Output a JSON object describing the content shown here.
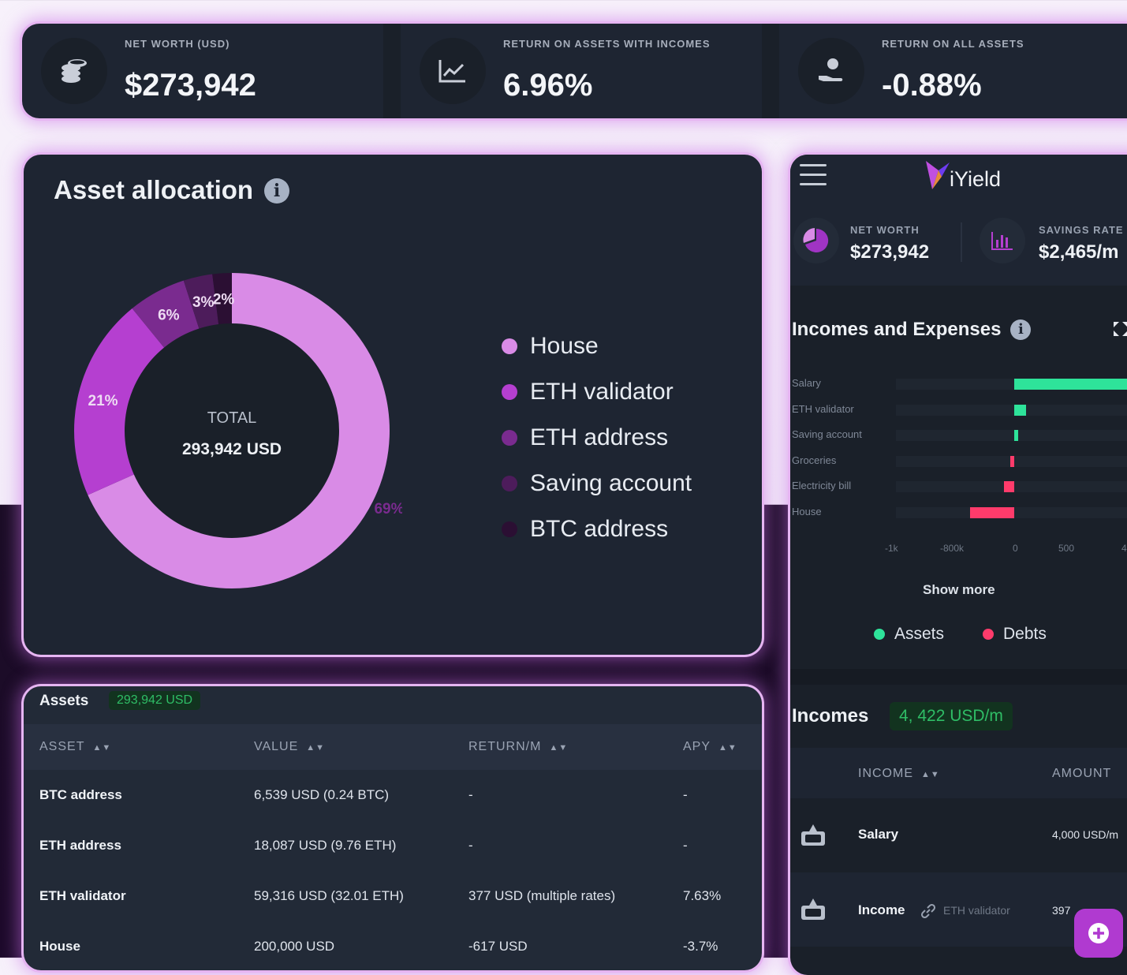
{
  "stats": [
    {
      "label": "NET WORTH (USD)",
      "value": "$273,942",
      "icon": "coins-icon"
    },
    {
      "label": "RETURN ON ASSETS WITH INCOMES",
      "value": "6.96%",
      "icon": "chart-line-icon"
    },
    {
      "label": "RETURN ON ALL ASSETS",
      "value": "-0.88%",
      "icon": "hand-coin-icon"
    }
  ],
  "allocation": {
    "title": "Asset allocation",
    "info_icon": "info-icon",
    "center_label": "TOTAL",
    "center_value": "293,942 USD",
    "legend": [
      {
        "label": "House",
        "color": "#d98be6"
      },
      {
        "label": "ETH validator",
        "color": "#b53fd0"
      },
      {
        "label": "ETH address",
        "color": "#7a2b8f"
      },
      {
        "label": "Saving account",
        "color": "#4d1c5b"
      },
      {
        "label": "BTC address",
        "color": "#2b0f33"
      }
    ]
  },
  "chart_data": {
    "type": "pie",
    "categories": [
      "House",
      "ETH validator",
      "ETH address",
      "Saving account",
      "BTC address"
    ],
    "values": [
      69,
      21,
      6,
      3,
      2
    ],
    "value_labels": [
      "69%",
      "21%",
      "6%",
      "3%",
      "2%"
    ],
    "colors": [
      "#d98be6",
      "#b53fd0",
      "#7a2b8f",
      "#4d1c5b",
      "#2b0f33"
    ]
  },
  "assets_table": {
    "title": "Assets",
    "total_badge": "293,942 USD",
    "columns": [
      "ASSET",
      "VALUE",
      "RETURN/M",
      "APY"
    ],
    "sort_icon": "sort-icon",
    "rows": [
      [
        "BTC address",
        "6,539 USD (0.24 BTC)",
        "-",
        "-"
      ],
      [
        "ETH address",
        "18,087 USD (9.76 ETH)",
        "-",
        "-"
      ],
      [
        "ETH validator",
        "59,316 USD (32.01 ETH)",
        "377 USD (multiple rates)",
        "7.63%"
      ],
      [
        "House",
        "200,000 USD",
        "-617 USD",
        "-3.7%"
      ]
    ]
  },
  "mobile": {
    "brand": "iYield",
    "menu_icon": "hamburger-menu-icon",
    "stats": [
      {
        "label": "NET WORTH",
        "value": "$273,942",
        "icon": "pie-chart-icon"
      },
      {
        "label": "SAVINGS RATE",
        "value": "$2,465/m",
        "icon": "bar-chart-icon"
      }
    ],
    "incomes_expenses": {
      "title": "Incomes and Expenses",
      "expand_icon": "expand-icon",
      "show_more": "Show more",
      "legend": [
        {
          "label": "Assets",
          "color": "#2ee39a"
        },
        {
          "label": "Debts",
          "color": "#ff3b6b"
        }
      ],
      "bars": [
        {
          "label": "Salary",
          "value": 4000,
          "color": "#2ee39a"
        },
        {
          "label": "ETH validator",
          "value": 377,
          "color": "#2ee39a"
        },
        {
          "label": "Saving account",
          "value": 45,
          "color": "#2ee39a"
        },
        {
          "label": "Groceries",
          "value": -50,
          "color": "#ff3b6b"
        },
        {
          "label": "Electricity bill",
          "value": -150,
          "color": "#ff3b6b"
        },
        {
          "label": "House",
          "value": -617,
          "color": "#ff3b6b"
        }
      ],
      "x_ticks": [
        "-1k",
        "-800k",
        "0",
        "500",
        "4"
      ]
    },
    "incomes": {
      "title": "Incomes",
      "badge": "4, 422 USD/m",
      "columns": [
        "INCOME",
        "AMOUNT"
      ],
      "rows": [
        {
          "icon": "money-bag-icon",
          "name": "Salary",
          "link": "",
          "amount": "4,000 USD/m"
        },
        {
          "icon": "money-bag-icon",
          "name": "Income",
          "link": "ETH validator",
          "amount": "397"
        }
      ]
    },
    "fab_icon": "plus-circle-icon"
  }
}
